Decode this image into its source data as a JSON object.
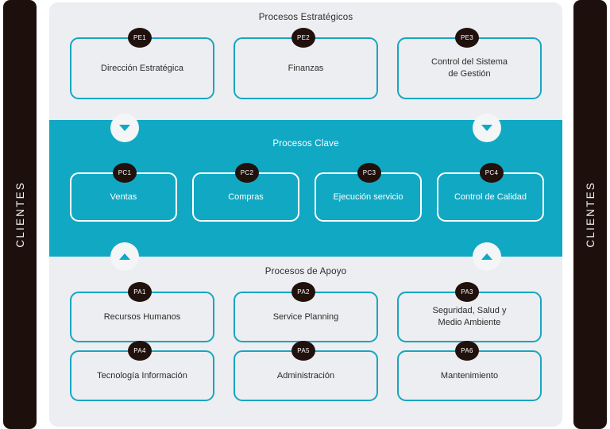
{
  "sides": {
    "left_label": "CLIENTES",
    "right_label": "CLIENTES"
  },
  "colors": {
    "teal": "#11a8c3",
    "card_border_teal": "#18a6c0",
    "panel_bg": "#eceef1",
    "dark_bar": "#1d100c",
    "badge_bg": "#21110d"
  },
  "bands": {
    "strategic": {
      "title": "Procesos Estratégicos",
      "cards": [
        {
          "badge": "PE1",
          "label": "Dirección Estratégica"
        },
        {
          "badge": "PE2",
          "label": "Finanzas"
        },
        {
          "badge": "PE3",
          "label": "Control del Sistema\nde Gestión"
        }
      ]
    },
    "key": {
      "title": "Procesos Clave",
      "cards": [
        {
          "badge": "PC1",
          "label": "Ventas"
        },
        {
          "badge": "PC2",
          "label": "Compras"
        },
        {
          "badge": "PC3",
          "label": "Ejecución servicio"
        },
        {
          "badge": "PC4",
          "label": "Control de Calidad"
        }
      ]
    },
    "support": {
      "title": "Procesos de Apoyo",
      "cards": [
        {
          "badge": "PA1",
          "label": "Recursos Humanos"
        },
        {
          "badge": "PA2",
          "label": "Service Planning"
        },
        {
          "badge": "PA3",
          "label": "Seguridad, Salud y\nMedio Ambiente"
        },
        {
          "badge": "PA4",
          "label": "Tecnología Información"
        },
        {
          "badge": "PA5",
          "label": "Administración"
        },
        {
          "badge": "PA6",
          "label": "Mantenimiento"
        }
      ]
    }
  },
  "connectors": [
    {
      "name": "arrow-down-left",
      "direction": "down"
    },
    {
      "name": "arrow-down-right",
      "direction": "down"
    },
    {
      "name": "arrow-up-left",
      "direction": "up"
    },
    {
      "name": "arrow-up-right",
      "direction": "up"
    }
  ]
}
